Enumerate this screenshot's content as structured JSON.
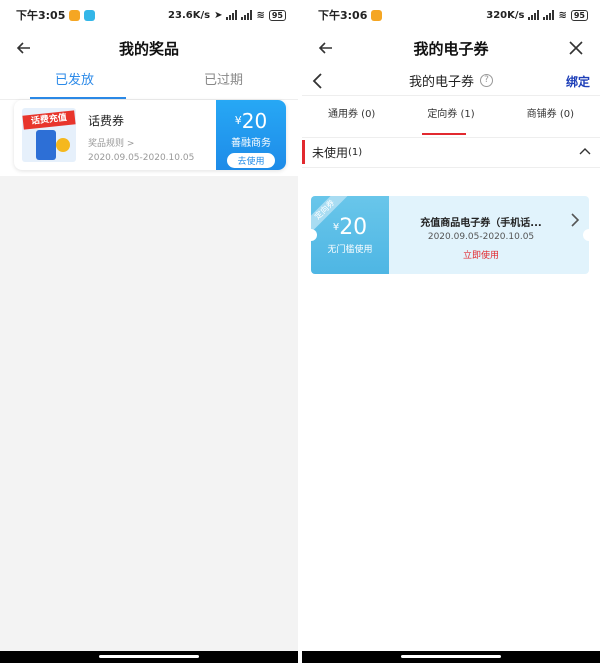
{
  "left": {
    "status": {
      "time": "下午3:05",
      "net": "23.6K/s",
      "battery": "95"
    },
    "nav": {
      "title": "我的奖品"
    },
    "tabs": [
      {
        "label": "已发放"
      },
      {
        "label": "已过期"
      }
    ],
    "prize": {
      "image_banner": "话费充值",
      "name": "话费券",
      "rule": "奖品规则 >",
      "date": "2020.09.05-2020.10.05",
      "currency": "¥",
      "amount": "20",
      "merchant": "善融商务",
      "button": "去使用"
    }
  },
  "right": {
    "status": {
      "time": "下午3:06",
      "net": "320K/s",
      "battery": "95"
    },
    "nav": {
      "title": "我的电子券"
    },
    "subbar": {
      "title": "我的电子券",
      "help": "?",
      "bind": "绑定"
    },
    "tabs": [
      {
        "label": "通用券 (0)"
      },
      {
        "label": "定向券 (1)"
      },
      {
        "label": "商铺券 (0)"
      }
    ],
    "section": {
      "label": "未使用",
      "count": "(1)"
    },
    "coupon": {
      "ribbon": "定向券",
      "currency": "¥",
      "amount": "20",
      "condition": "无门槛使用",
      "name": "充值商品电子券（手机话...",
      "date": "2020.09.05-2020.10.05",
      "action": "立即使用"
    }
  },
  "colors": {
    "accent_blue": "#2c8ae8",
    "accent_red": "#e2292f",
    "bind_blue": "#1e3fb8"
  }
}
